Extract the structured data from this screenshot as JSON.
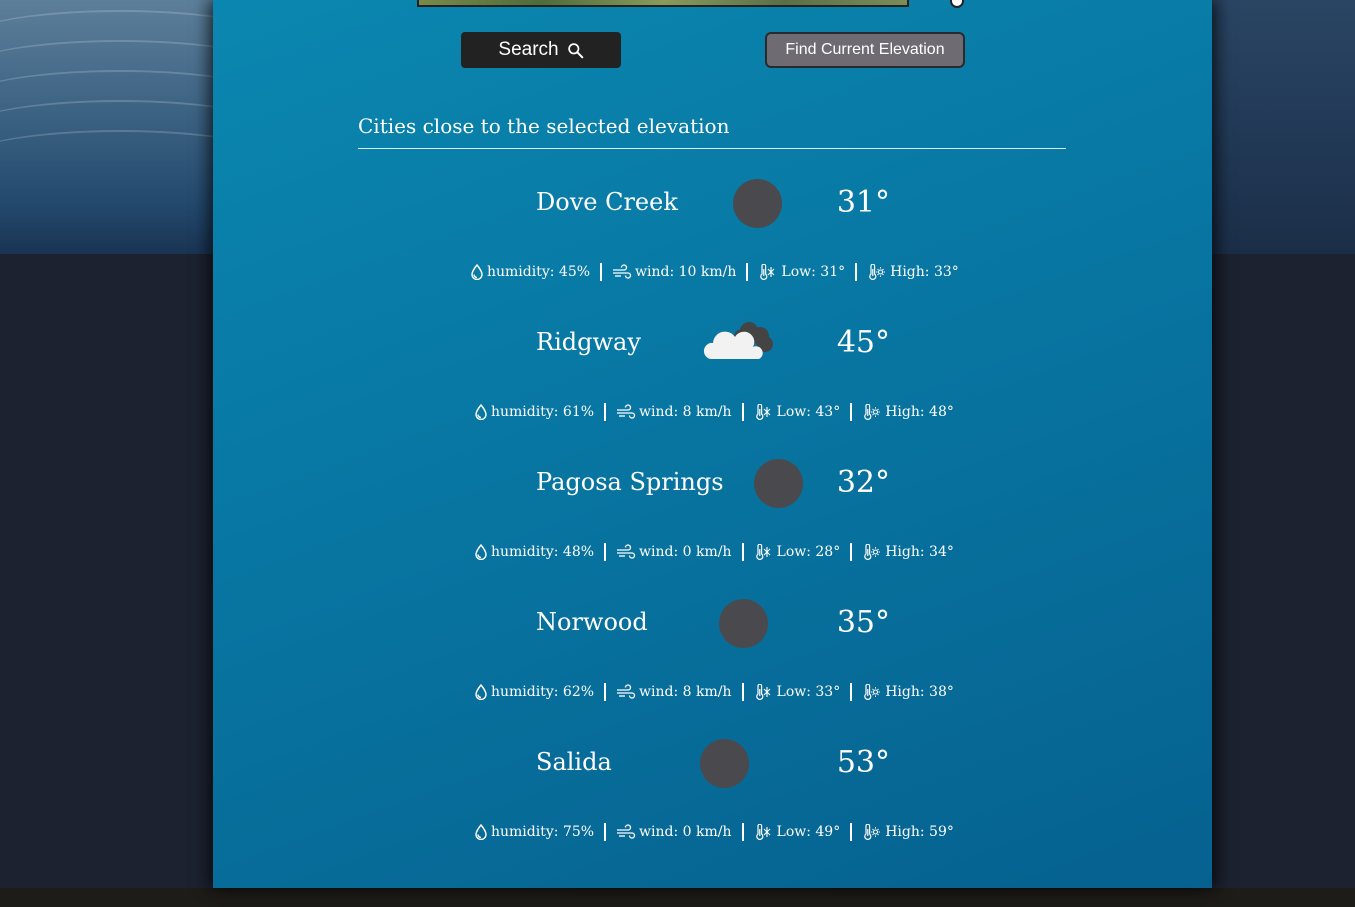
{
  "buttons": {
    "search_label": "Search",
    "find_elevation_label": "Find Current Elevation"
  },
  "section": {
    "title": "Cities close to the selected elevation"
  },
  "cities": [
    {
      "name": "Dove Creek",
      "temp": "31°",
      "icon": "blank-dot",
      "humidity": "humidity: 45%",
      "wind": "wind: 10 km/h",
      "low": "Low: 31°",
      "high": "High: 33°"
    },
    {
      "name": "Ridgway",
      "temp": "45°",
      "icon": "cloud-icon",
      "humidity": "humidity: 61%",
      "wind": "wind: 8 km/h",
      "low": "Low: 43°",
      "high": "High: 48°"
    },
    {
      "name": "Pagosa Springs",
      "temp": "32°",
      "icon": "blank-dot",
      "humidity": "humidity: 48%",
      "wind": "wind: 0 km/h",
      "low": "Low: 28°",
      "high": "High: 34°"
    },
    {
      "name": "Norwood",
      "temp": "35°",
      "icon": "blank-dot",
      "humidity": "humidity: 62%",
      "wind": "wind: 8 km/h",
      "low": "Low: 33°",
      "high": "High: 38°"
    },
    {
      "name": "Salida",
      "temp": "53°",
      "icon": "blank-dot",
      "humidity": "humidity: 75%",
      "wind": "wind: 0 km/h",
      "low": "Low: 49°",
      "high": "High: 59°"
    }
  ],
  "colors": {
    "panel": "#0876a2",
    "page_background": "#1c2230",
    "search_button": "#222222",
    "elevation_button": "#6e6c72",
    "icon_dot": "#4a4a4e"
  }
}
